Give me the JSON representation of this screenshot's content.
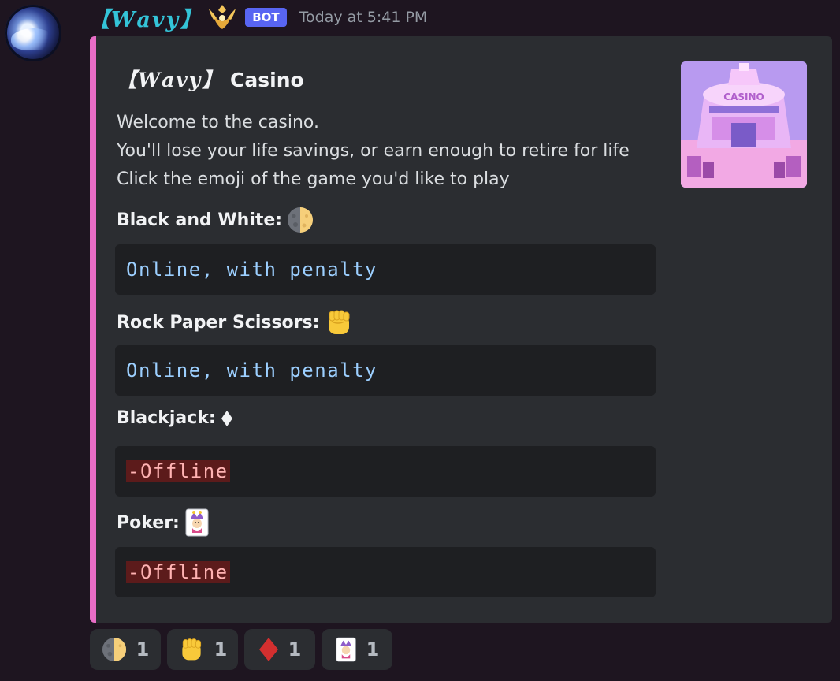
{
  "message": {
    "username": "【𝑾𝒂𝒗𝒚】",
    "badge": "BOT",
    "timestamp": "Today at 5:41 PM"
  },
  "embed": {
    "accent_color": "#e86dc6",
    "title_brand": "【𝑾𝒂𝒗𝒚】",
    "title_text": "Casino",
    "description": [
      "Welcome to the casino.",
      "You'll lose your life savings, or earn enough to retire for life",
      "Click the emoji of the game you'd like to play"
    ],
    "fields": [
      {
        "name": "Black and White:",
        "emoji": "moon-half-icon",
        "status": "Online, with penalty",
        "status_color": "#9ccfff"
      },
      {
        "name": "Rock Paper Scissors:",
        "emoji": "fist-icon",
        "status": "Online, with penalty",
        "status_color": "#9ccfff"
      },
      {
        "name": "Blackjack:",
        "emoji": "diamond-icon",
        "status": "-Offline",
        "status_color": "#ffb3b3"
      },
      {
        "name": "Poker:",
        "emoji": "joker-card-icon",
        "status": "-Offline",
        "status_color": "#ffb3b3"
      }
    ]
  },
  "reactions": [
    {
      "emoji": "moon-half-icon",
      "count": "1"
    },
    {
      "emoji": "fist-icon",
      "count": "1"
    },
    {
      "emoji": "diamond-icon",
      "count": "1"
    },
    {
      "emoji": "joker-card-icon",
      "count": "1"
    }
  ]
}
